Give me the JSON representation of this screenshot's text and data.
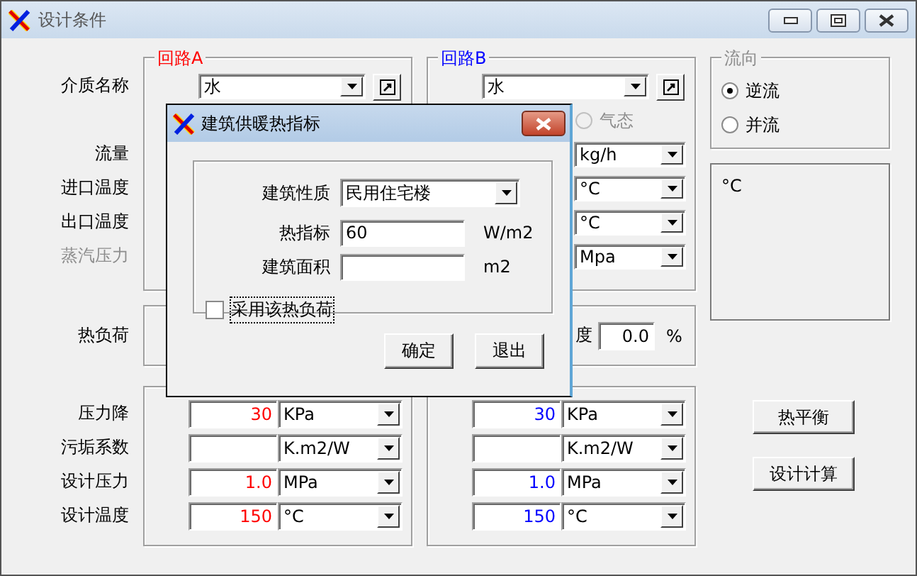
{
  "window": {
    "title": "设计条件"
  },
  "row_labels": [
    {
      "text": "介质名称",
      "disabled": false
    },
    {
      "text": "流量",
      "disabled": false
    },
    {
      "text": "进口温度",
      "disabled": false
    },
    {
      "text": "出口温度",
      "disabled": false
    },
    {
      "text": "蒸汽压力",
      "disabled": true
    }
  ],
  "heat_load_label": "热负荷",
  "design_labels": [
    "压力降",
    "污垢系数",
    "设计压力",
    "设计温度"
  ],
  "circuits": [
    {
      "title": "回路A",
      "color": "#ff0000",
      "medium": "水",
      "design": [
        {
          "value": "30",
          "unit": "KPa"
        },
        {
          "unit": "K.m2/W"
        },
        {
          "value": "1.0",
          "unit": "MPa"
        },
        {
          "value": "150",
          "unit": "°C"
        }
      ]
    },
    {
      "title": "回路B",
      "color": "#0000ff",
      "medium": "水",
      "phase_option": {
        "label": "气态",
        "disabled": true,
        "selected": false
      },
      "units": [
        "kg/h",
        "°C",
        "°C",
        "Mpa"
      ],
      "heat_load": {
        "label": "度",
        "value": "0.0",
        "unit": "%"
      },
      "design": [
        {
          "value": "30",
          "unit": "KPa"
        },
        {
          "unit": "K.m2/W"
        },
        {
          "value": "1.0",
          "unit": "MPa"
        },
        {
          "value": "150",
          "unit": "°C"
        }
      ]
    }
  ],
  "flow_direction": {
    "title": "流向",
    "options": [
      {
        "label": "逆流",
        "selected": true
      },
      {
        "label": "并流",
        "selected": false
      }
    ]
  },
  "result": {
    "text": "°C"
  },
  "buttons": [
    "热平衡",
    "设计计算"
  ],
  "dialog": {
    "title": "建筑供暖热指标",
    "fields": [
      {
        "kind": "dropdown",
        "label": "建筑性质",
        "value": "民用住宅楼"
      },
      {
        "kind": "input",
        "label": "热指标",
        "value": "60",
        "unit": "W/m2"
      },
      {
        "kind": "input",
        "label": "建筑面积",
        "unit": "m2"
      }
    ],
    "checkbox": {
      "label": "采用该热负荷",
      "checked": false,
      "focused": true
    },
    "buttons": [
      "确定",
      "退出"
    ]
  }
}
